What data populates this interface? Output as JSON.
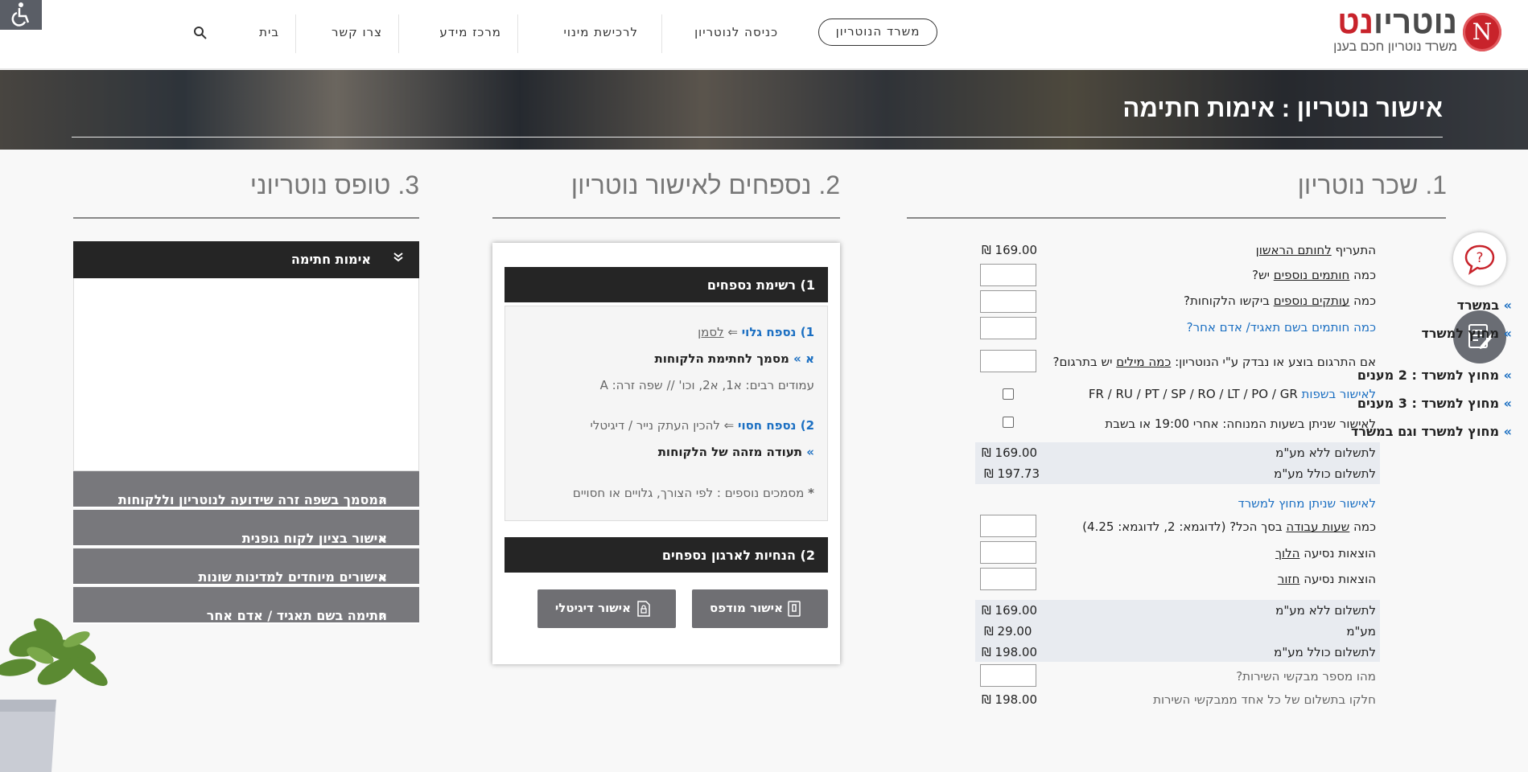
{
  "header": {
    "logo_letter": "N",
    "logo_main": "נוטריו",
    "logo_accent": "נט",
    "logo_tagline": "משרד נוטריון חכם בענן",
    "nav": {
      "office": "משרד הנוטריון",
      "login": "כניסה לנוטריון",
      "buy_appointment": "לרכישת מינוי",
      "info_center": "מרכז מידע",
      "contact": "צרו קשר",
      "home": "בית"
    }
  },
  "hero": {
    "title": "אישור נוטריון : אימות חתימה"
  },
  "fee_section": {
    "title": "1. שכר נוטריון",
    "rows": {
      "first_signer_prefix": "התעריף",
      "first_signer_link": "לחותם הראשון",
      "first_signer_amount": "₪ 169.00",
      "extra_signers_prefix": "כמה",
      "extra_signers_link": "חותמים נוספים",
      "extra_signers_suffix": "יש?",
      "extra_copies_prefix": "כמה",
      "extra_copies_link": "עותקים נוספים",
      "extra_copies_suffix": "ביקשו הלקוחות?",
      "corp_signers": "כמה חותמים בשם תאגיד/ אדם אחר?",
      "translation_prefix": "אם התרגום בוצע או נבדק ע\"י הנוטריון:",
      "translation_link": "כמה מילים",
      "translation_suffix": "יש בתרגום?",
      "languages_label": "לאישור בשפות",
      "languages_codes": "FR / RU / PT / SP / RO / LT / PO / GR",
      "rest_hours": "לאישור שניתן בשעות המנוחה: אחרי 19:00 או בשבת",
      "pay_no_vat_label": "לתשלום ללא מע\"מ",
      "pay_no_vat_amount": "₪ 169.00",
      "pay_with_vat_label": "לתשלום כולל מע\"מ",
      "pay_with_vat_amount": "₪ 197.73",
      "outside_office": "לאישור שניתן מחוץ למשרד",
      "work_hours_prefix": "כמה",
      "work_hours_link": "שעות עבודה",
      "work_hours_suffix": "בסך הכל? (לדוגמא: 2, לדוגמא: 4.25)",
      "travel_there_prefix": "הוצאות נסיעה",
      "travel_there_link": "הלוך",
      "travel_back_prefix": "הוצאות נסיעה",
      "travel_back_link": "חזור",
      "total_no_vat_label": "לתשלום ללא מע\"מ",
      "total_no_vat_amount": "₪ 169.00",
      "vat_label": "מע\"מ",
      "vat_amount": "₪ 29.00",
      "total_with_vat_label": "לתשלום כולל מע\"מ",
      "total_with_vat_amount": "₪ 198.00",
      "requesters_label": "מהו מספר מבקשי השירות?",
      "split_label": "חלקו בתשלום של כל אחד ממבקשי השירות",
      "split_amount": "₪ 198.00"
    }
  },
  "appendix_section": {
    "title": "2. נספחים לאישור נוטריון",
    "list_header": "1) רשימת נספחים",
    "visible_label": "1) נספח גלוי",
    "visible_arrow": "⇐",
    "visible_link": "לסמן",
    "doc_a_prefix": "א »",
    "doc_a": "מסמך לחתימת הלקוחות",
    "multi_pages": "עמודים רבים: א1, א2, וכו' // שפה זרה: A",
    "hidden_label": "2) נספח חסוי",
    "hidden_note": "⇐ להכין העתק נייר / דיגיטלי",
    "id_doc": "תעודה מזהה של הלקוחות",
    "extra_docs": "מסמכים נוספים : לפי הצורך, גלויים או חסויים",
    "extra_docs_star": "*",
    "instructions_header": "2) הנחיות לארגון נספחים",
    "printed_button": "אישור מודפס",
    "digital_button": "אישור דיגיטלי"
  },
  "form_section": {
    "title": "3. טופס נוטריוני",
    "accordion_open": "אימות חתימה",
    "options": {
      "in_office": "במשרד",
      "outside": "מחוץ למשרד",
      "outside_2": "מחוץ למשרד : 2 מענים",
      "outside_3": "מחוץ למשרד : 3 מענים",
      "outside_and_in": "מחוץ למשרד וגם במשרד"
    },
    "chevron": "»",
    "collapsed": {
      "foreign_language": "המסמך בשפה זרה שידועה לנוטריון וללקוחות",
      "corporate_client": "אישור בציון לקוח גופנית",
      "special_countries": "אישורים מיוחדים למדינות שונות",
      "on_behalf": "חתימה בשם תאגיד / אדם אחר"
    }
  },
  "icons": {
    "search": "search-icon",
    "chat": "chat-question-icon",
    "note": "note-edit-icon",
    "accessibility": "wheelchair-icon"
  },
  "colors": {
    "brand_red": "#c8232b",
    "link_blue": "#1b6fc2",
    "dark_bar": "#252525",
    "gray_bar": "#78787c"
  }
}
